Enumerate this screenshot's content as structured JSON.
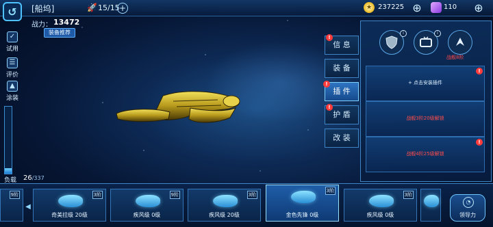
{
  "header": {
    "title": "[船坞]",
    "fleet_count": "15/15",
    "gold": "237225",
    "crystal": "110"
  },
  "power": {
    "label": "战力：",
    "value": "13472",
    "recommend_label": "装备推荐"
  },
  "side_menu": [
    {
      "label": "试用",
      "icon": "tryout-icon"
    },
    {
      "label": "评价",
      "icon": "review-icon"
    },
    {
      "label": "涂装",
      "icon": "paint-icon"
    }
  ],
  "load": {
    "label": "负载",
    "value": "26",
    "max": "/337",
    "fill_fraction": 0.077
  },
  "tabs": [
    {
      "label": "信 息",
      "alert": true
    },
    {
      "label": "装 备",
      "alert": false
    },
    {
      "label": "插 件",
      "alert": true,
      "active": true
    },
    {
      "label": "护 盾",
      "alert": true
    },
    {
      "label": "改 装",
      "alert": false
    }
  ],
  "panel": {
    "icon_badges": [
      "i",
      "i"
    ],
    "lock_note": "战舰8阶",
    "slots": [
      {
        "text": "+  点击安装插件",
        "type": "add",
        "alert": true
      },
      {
        "text": "战舰3阶20级解锁",
        "type": "lock",
        "alert": false
      },
      {
        "text": "战舰4阶25级解锁",
        "type": "lock",
        "alert": true
      }
    ]
  },
  "ships": [
    {
      "name": "奇美拉级 20级",
      "level": "3阶",
      "active": false
    },
    {
      "name": "疾风级 0级",
      "level": "9阶",
      "active": false
    },
    {
      "name": "疾风级 20级",
      "level": "3阶",
      "active": false
    },
    {
      "name": "金色先锋 0级",
      "level": "3阶",
      "active": true
    },
    {
      "name": "疾风级 0级",
      "level": "3阶",
      "active": false
    }
  ],
  "partial_ship_level_left": "9阶",
  "lead_button": {
    "label": "领导力"
  },
  "colors": {
    "accent": "#4fc3ff",
    "alert": "#ff3b3b",
    "lock_text": "#ff4c4c",
    "ship_gold": "#b89a1c"
  }
}
